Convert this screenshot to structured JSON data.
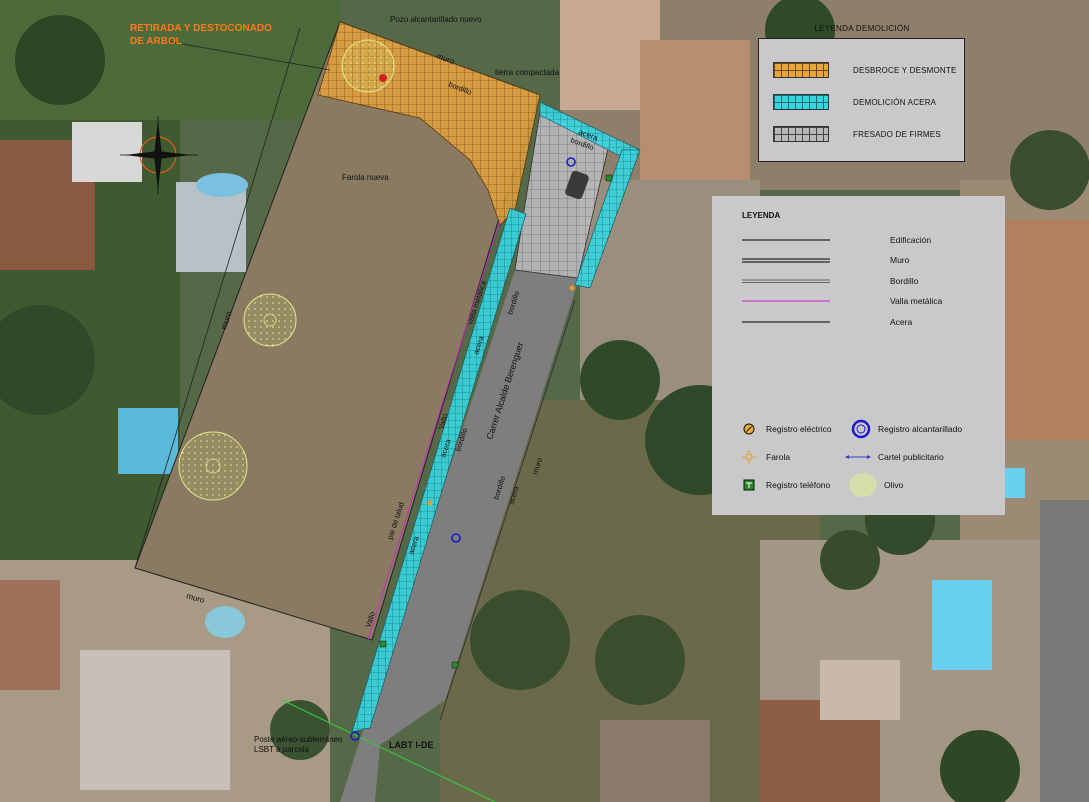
{
  "annotations": {
    "tree_removal_line1": "RETIRADA Y DESTOCONADO",
    "tree_removal_line2": "DE ARBOL",
    "sewer_new": "Pozo alcantarillado nuevo",
    "muro_top": "muro",
    "bordillo_top": "bordillo",
    "tierra": "tierra compactada",
    "farola_nueva": "Farola nueva",
    "acera_top": "acera",
    "bordillo_top2": "bordillo",
    "muro_left": "muro",
    "valla_metalica": "valla metálica",
    "acera_mid": "acera",
    "bordillo_mid": "bordillo",
    "street_name": "Carrer Alcalde Berenguer",
    "vallo1": "Vallo",
    "bordillo_mid2": "bordillo",
    "acera_mid2": "acera",
    "bordillo_right": "bordillo",
    "acera_right": "acera",
    "muro_right": "muro",
    "pie_talud": "pie de talud",
    "acera_low": "acera",
    "vallo2": "Vallo",
    "muro_bottom": "muro",
    "poste_line1": "Poste aéreo-subterráneo",
    "poste_line2": "LSBT a parcela",
    "labt": "LABT I-DE"
  },
  "demolition_legend": {
    "title": "LEYENDA DEMOLICIÓN",
    "items": [
      {
        "label": "DESBROCE Y DESMONTE",
        "color": "#e8a63a"
      },
      {
        "label": "DEMOLICIÓN ACERA",
        "color": "#35d6e0"
      },
      {
        "label": "FRESADO DE FIRMES",
        "color": "#b9b9bc"
      }
    ]
  },
  "legend": {
    "title": "LEYENDA",
    "lines": [
      {
        "label": "Edificación",
        "color": "#000000"
      },
      {
        "label": "Muro",
        "color": "#000000"
      },
      {
        "label": "Bordillo",
        "color": "#000000"
      },
      {
        "label": "Valla metálica",
        "color": "#d020d0"
      },
      {
        "label": "Acera",
        "color": "#000000"
      }
    ],
    "symbols": {
      "registro_electrico": "Registro eléctrico",
      "registro_alcantarillado": "Registro alcantarillado",
      "farola": "Farola",
      "cartel": "Cartel publicitario",
      "registro_telefono": "Registro teléfono",
      "olivo": "Olivo"
    }
  },
  "colors": {
    "desbroce": "#e8a63a",
    "acera_demolition": "#35d6e0",
    "fresado": "#b9b9bc",
    "label_orange": "#ff7a1a",
    "sewer_blue": "#1a1acc",
    "olive": "#d8e87a"
  }
}
